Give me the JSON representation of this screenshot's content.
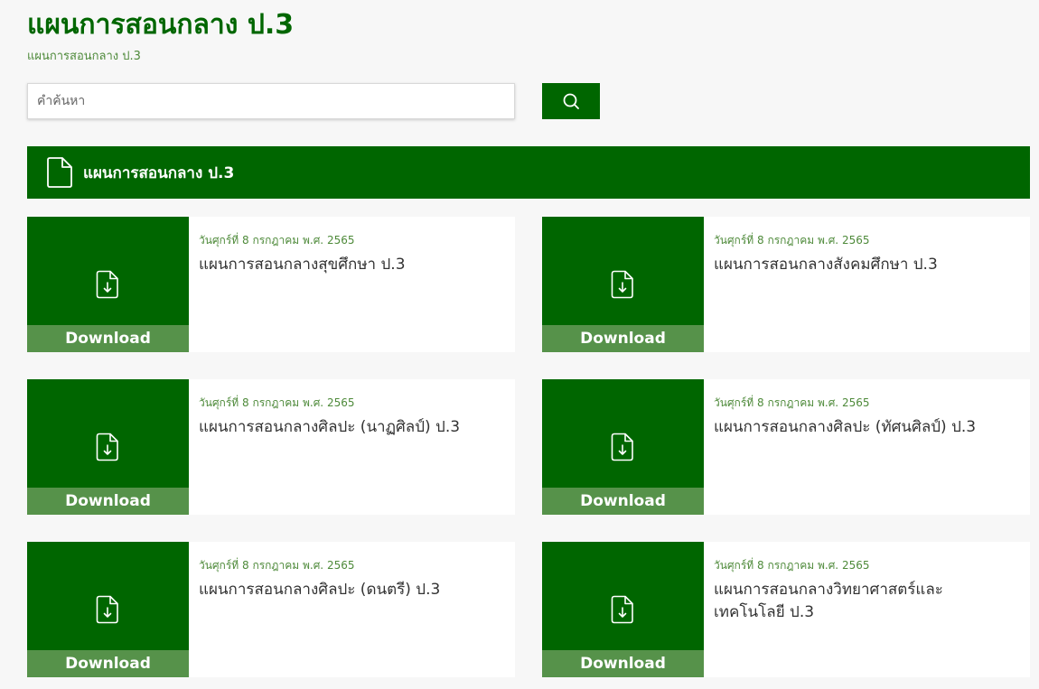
{
  "header": {
    "title": "แผนการสอนกลาง ป.3",
    "subtitle": "แผนการสอนกลาง ป.3"
  },
  "search": {
    "placeholder": "คำค้นหา",
    "value": ""
  },
  "section": {
    "title": "แผนการสอนกลาง ป.3"
  },
  "cards": [
    {
      "date": "วันศุกร์ที่ 8 กรกฎาคม พ.ศ. 2565",
      "title": "แผนการสอนกลางสุขศึกษา ป.3",
      "download_label": "Download"
    },
    {
      "date": "วันศุกร์ที่ 8 กรกฎาคม พ.ศ. 2565",
      "title": "แผนการสอนกลางสังคมศึกษา ป.3",
      "download_label": "Download"
    },
    {
      "date": "วันศุกร์ที่ 8 กรกฎาคม พ.ศ. 2565",
      "title": "แผนการสอนกลางศิลปะ (นาฏศิลป์) ป.3",
      "download_label": "Download"
    },
    {
      "date": "วันศุกร์ที่ 8 กรกฎาคม พ.ศ. 2565",
      "title": "แผนการสอนกลางศิลปะ (ทัศนศิลป์) ป.3",
      "download_label": "Download"
    },
    {
      "date": "วันศุกร์ที่ 8 กรกฎาคม พ.ศ. 2565",
      "title": "แผนการสอนกลางศิลปะ (ดนตรี) ป.3",
      "download_label": "Download"
    },
    {
      "date": "วันศุกร์ที่ 8 กรกฎาคม พ.ศ. 2565",
      "title": "แผนการสอนกลางวิทยาศาสตร์และเทคโนโลยี ป.3",
      "download_label": "Download"
    }
  ],
  "icons": {
    "search": "search-icon",
    "section": "document-icon",
    "card": "file-download-icon"
  },
  "colors": {
    "primary": "#006600",
    "download_bar": "#56924a",
    "date_text": "#4e8a3a",
    "title_text": "#333333",
    "background": "#f7f7f7"
  }
}
